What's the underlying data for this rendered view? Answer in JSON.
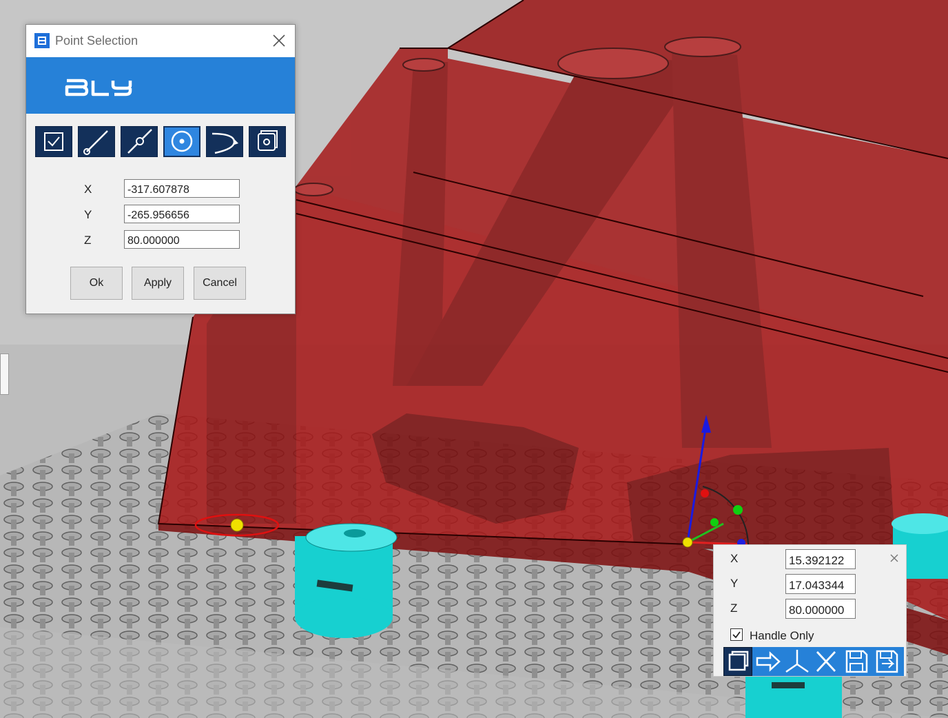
{
  "point_selection": {
    "title": "Point Selection",
    "brand": "BLY",
    "toolbar": [
      {
        "icon": "checkbox-select-icon"
      },
      {
        "icon": "line-icon"
      },
      {
        "icon": "line-midpoint-icon"
      },
      {
        "icon": "circle-center-icon",
        "active": true
      },
      {
        "icon": "arc-icon"
      },
      {
        "icon": "face-center-icon"
      }
    ],
    "x_label": "X",
    "x_value": "-317.607878",
    "y_label": "Y",
    "y_value": "-265.956656",
    "z_label": "Z",
    "z_value": "80.000000",
    "ok_label": "Ok",
    "apply_label": "Apply",
    "cancel_label": "Cancel"
  },
  "coord_panel": {
    "x_label": "X",
    "x_value": "15.392122",
    "y_label": "Y",
    "y_value": "17.043344",
    "z_label": "Z",
    "z_value": "80.000000",
    "handle_only_label": "Handle Only",
    "handle_only_checked": true,
    "toolbar": [
      {
        "icon": "new-frame-icon"
      },
      {
        "icon": "arrow-right-icon"
      },
      {
        "icon": "axes-icon"
      },
      {
        "icon": "close-x-icon"
      },
      {
        "icon": "save-icon"
      },
      {
        "icon": "save-as-icon"
      }
    ]
  },
  "colors": {
    "accent_blue": "#2681d8",
    "toolbar_navy": "#13305a",
    "fixture_red": "#a31616",
    "cylinder_cyan": "#17d0d0",
    "handle_yellow": "#f0e000"
  }
}
